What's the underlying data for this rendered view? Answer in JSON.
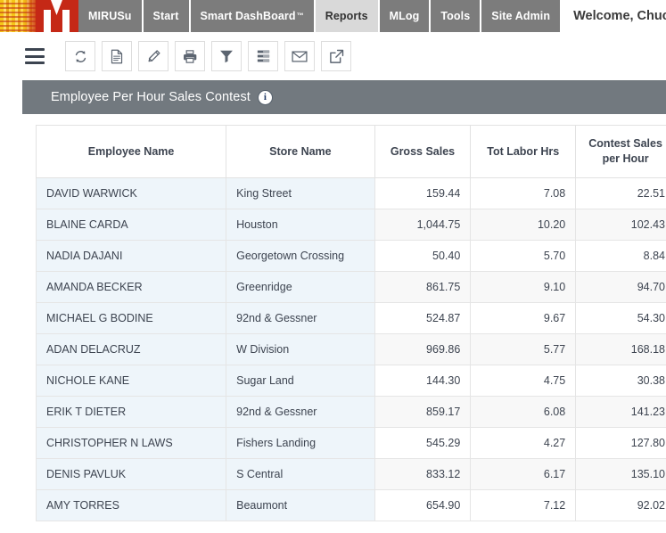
{
  "header": {
    "logo_name": "mirus-m-logo",
    "nav_tabs": [
      {
        "label": "MIRUSu",
        "active": false
      },
      {
        "label": "Start",
        "active": false
      },
      {
        "label": "Smart DashBoard",
        "trademark": "™",
        "active": false
      },
      {
        "label": "Reports",
        "active": true
      },
      {
        "label": "MLog",
        "active": false
      },
      {
        "label": "Tools",
        "active": false
      },
      {
        "label": "Site Admin",
        "active": false
      }
    ],
    "welcome_text": "Welcome, Chuck Bartlett"
  },
  "toolbar": {
    "menu_icon": "hamburger-menu-icon",
    "buttons": [
      {
        "name": "refresh-button",
        "icon": "refresh-icon"
      },
      {
        "name": "document-button",
        "icon": "document-icon"
      },
      {
        "name": "edit-button",
        "icon": "pencil-icon"
      },
      {
        "name": "print-button",
        "icon": "printer-icon"
      },
      {
        "name": "filter-button",
        "icon": "funnel-icon"
      },
      {
        "name": "columns-button",
        "icon": "list-settings-icon"
      },
      {
        "name": "email-button",
        "icon": "envelope-icon"
      },
      {
        "name": "export-button",
        "icon": "external-link-icon"
      }
    ]
  },
  "panel": {
    "title": "Employee Per Hour Sales Contest",
    "info_icon_label": "i"
  },
  "table": {
    "columns": [
      "Employee Name",
      "Store Name",
      "Gross Sales",
      "Tot Labor Hrs",
      "Contest Sales per Hour"
    ],
    "column_header_lines": [
      [
        "Employee Name"
      ],
      [
        "Store Name"
      ],
      [
        "Gross Sales"
      ],
      [
        "Tot Labor Hrs"
      ],
      [
        "Contest Sales",
        "per Hour"
      ]
    ],
    "rows": [
      {
        "employee_name": "DAVID WARWICK",
        "store_name": "King Street",
        "gross_sales": "159.44",
        "tot_labor_hrs": "7.08",
        "contest_sales_per_hour": "22.51"
      },
      {
        "employee_name": "BLAINE CARDA",
        "store_name": "Houston",
        "gross_sales": "1,044.75",
        "tot_labor_hrs": "10.20",
        "contest_sales_per_hour": "102.43"
      },
      {
        "employee_name": "NADIA DAJANI",
        "store_name": "Georgetown Crossing",
        "gross_sales": "50.40",
        "tot_labor_hrs": "5.70",
        "contest_sales_per_hour": "8.84"
      },
      {
        "employee_name": "AMANDA BECKER",
        "store_name": "Greenridge",
        "gross_sales": "861.75",
        "tot_labor_hrs": "9.10",
        "contest_sales_per_hour": "94.70"
      },
      {
        "employee_name": "MICHAEL G BODINE",
        "store_name": "92nd & Gessner",
        "gross_sales": "524.87",
        "tot_labor_hrs": "9.67",
        "contest_sales_per_hour": "54.30"
      },
      {
        "employee_name": "ADAN DELACRUZ",
        "store_name": "W Division",
        "gross_sales": "969.86",
        "tot_labor_hrs": "5.77",
        "contest_sales_per_hour": "168.18"
      },
      {
        "employee_name": "NICHOLE KANE",
        "store_name": "Sugar Land",
        "gross_sales": "144.30",
        "tot_labor_hrs": "4.75",
        "contest_sales_per_hour": "30.38"
      },
      {
        "employee_name": "ERIK T DIETER",
        "store_name": "92nd & Gessner",
        "gross_sales": "859.17",
        "tot_labor_hrs": "6.08",
        "contest_sales_per_hour": "141.23"
      },
      {
        "employee_name": "CHRISTOPHER N LAWS",
        "store_name": "Fishers Landing",
        "gross_sales": "545.29",
        "tot_labor_hrs": "4.27",
        "contest_sales_per_hour": "127.80"
      },
      {
        "employee_name": "DENIS PAVLUK",
        "store_name": "S Central",
        "gross_sales": "833.12",
        "tot_labor_hrs": "6.17",
        "contest_sales_per_hour": "135.10"
      },
      {
        "employee_name": "AMY TORRES",
        "store_name": "Beaumont",
        "gross_sales": "654.90",
        "tot_labor_hrs": "7.12",
        "contest_sales_per_hour": "92.02"
      }
    ]
  },
  "colors": {
    "brand_red": "#c52816",
    "brand_gold": "#f5c518",
    "nav_tab_bg": "#7c7c7c",
    "nav_tab_active_bg": "#d9d9d9",
    "panel_header_bg": "#72797f",
    "text_column_bg": "#eef5fa",
    "row_stripe_bg": "#f8f8f8"
  }
}
